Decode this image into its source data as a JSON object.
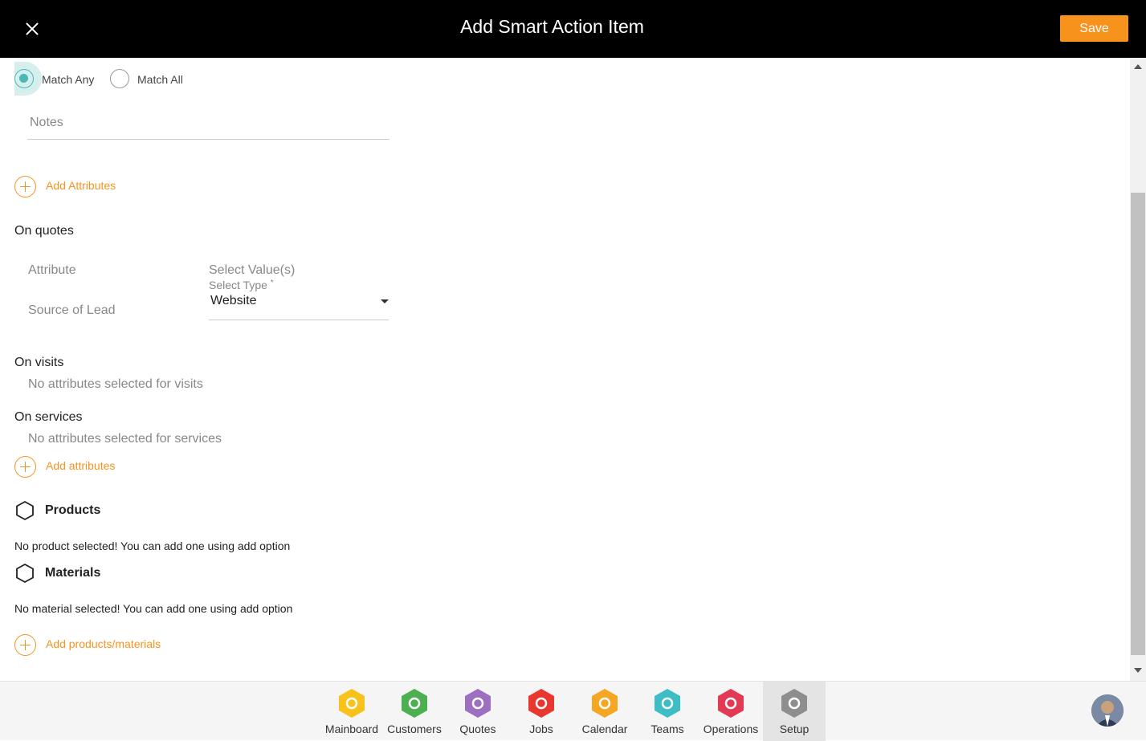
{
  "header": {
    "title": "Add Smart Action Item",
    "save_label": "Save"
  },
  "match": {
    "any_label": "Match Any",
    "all_label": "Match All",
    "selected": "any"
  },
  "notes": {
    "placeholder": "Notes"
  },
  "add_attributes_label": "Add Attributes",
  "quotes": {
    "heading": "On quotes",
    "col_attribute": "Attribute",
    "col_values": "Select Value(s)",
    "row_attribute": "Source of Lead",
    "select_label": "Select Type",
    "required_mark": "*",
    "select_value": "Website"
  },
  "visits": {
    "heading": "On visits",
    "empty": "No attributes selected for visits"
  },
  "services": {
    "heading": "On services",
    "empty": "No attributes selected for services"
  },
  "add_attributes2_label": "Add attributes",
  "products": {
    "heading": "Products",
    "empty": "No product selected! You can add one using add option"
  },
  "materials": {
    "heading": "Materials",
    "empty": "No material selected! You can add one using add option"
  },
  "add_products_label": "Add products/materials",
  "nav": [
    {
      "label": "Mainboard",
      "icon": "mainboard-icon",
      "color": "#f9c21b"
    },
    {
      "label": "Customers",
      "icon": "customers-icon",
      "color": "#4caf50"
    },
    {
      "label": "Quotes",
      "icon": "quotes-icon",
      "color": "#9c6fc0"
    },
    {
      "label": "Jobs",
      "icon": "jobs-icon",
      "color": "#e8372e"
    },
    {
      "label": "Calendar",
      "icon": "calendar-icon",
      "color": "#f5a623"
    },
    {
      "label": "Teams",
      "icon": "teams-icon",
      "color": "#3dbdc4"
    },
    {
      "label": "Operations",
      "icon": "operations-icon",
      "color": "#e23a54"
    },
    {
      "label": "Setup",
      "icon": "setup-icon",
      "color": "#8e8e8e"
    }
  ],
  "nav_active": "Setup",
  "colors": {
    "accent": "#f7931d",
    "radio": "#4cb8b6",
    "header_bg": "#000000"
  }
}
